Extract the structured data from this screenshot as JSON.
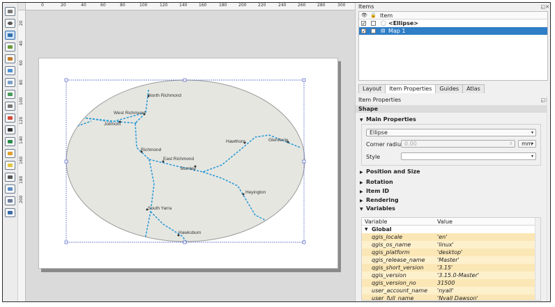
{
  "rulers": {
    "top": [
      "0",
      "20",
      "40",
      "60",
      "80",
      "100",
      "120",
      "140",
      "160",
      "180",
      "200",
      "220",
      "240",
      "260",
      "280",
      "300"
    ],
    "left": [
      "20",
      "40",
      "60",
      "80",
      "100",
      "120",
      "140",
      "160",
      "180",
      "200"
    ]
  },
  "map": {
    "places": [
      "North Richmond",
      "West Richmond",
      "Jolimont",
      "Hawthorn",
      "Glenferrie",
      "Richmond",
      "East Richmond",
      "Burnley",
      "Heyington",
      "South Yarra",
      "Hawksburn"
    ],
    "colors": {
      "ellipse_fill": "#e6e6e1",
      "ellipse_stroke": "#9a9a9a",
      "rail": "#2b9bd6",
      "selection": "#4a5fc1"
    }
  },
  "items_panel": {
    "title": "Items",
    "column_item": "Item",
    "rows": [
      {
        "name": "<Ellipse>",
        "checked": "✓",
        "selected": false
      },
      {
        "name": "Map 1",
        "checked": "✓",
        "selected": true
      }
    ]
  },
  "tabs": [
    "Layout",
    "Item Properties",
    "Guides",
    "Atlas"
  ],
  "active_tab": "Item Properties",
  "item_properties": {
    "title": "Item Properties",
    "shape_label": "Shape",
    "main_properties": "Main Properties",
    "shape_type": "Ellipse",
    "corner_radius_label": "Corner radius",
    "corner_radius_value": "0.00",
    "corner_radius_unit": "mm",
    "style_label": "Style",
    "sections": [
      "Position and Size",
      "Rotation",
      "Item ID",
      "Rendering",
      "Variables"
    ]
  },
  "variables": {
    "col_variable": "Variable",
    "col_value": "Value",
    "group": "Global",
    "rows": [
      {
        "name": "qgis_locale",
        "value": "'en'"
      },
      {
        "name": "qgis_os_name",
        "value": "'linux'"
      },
      {
        "name": "qgis_platform",
        "value": "'desktop'"
      },
      {
        "name": "qgis_release_name",
        "value": "'Master'"
      },
      {
        "name": "qgis_short_version",
        "value": "'3.15'"
      },
      {
        "name": "qgis_version",
        "value": "'3.15.0-Master'"
      },
      {
        "name": "qgis_version_no",
        "value": "31500"
      },
      {
        "name": "user_account_name",
        "value": "'nyall'"
      },
      {
        "name": "user_full_name",
        "value": "'Nyall Dawson'"
      }
    ]
  }
}
